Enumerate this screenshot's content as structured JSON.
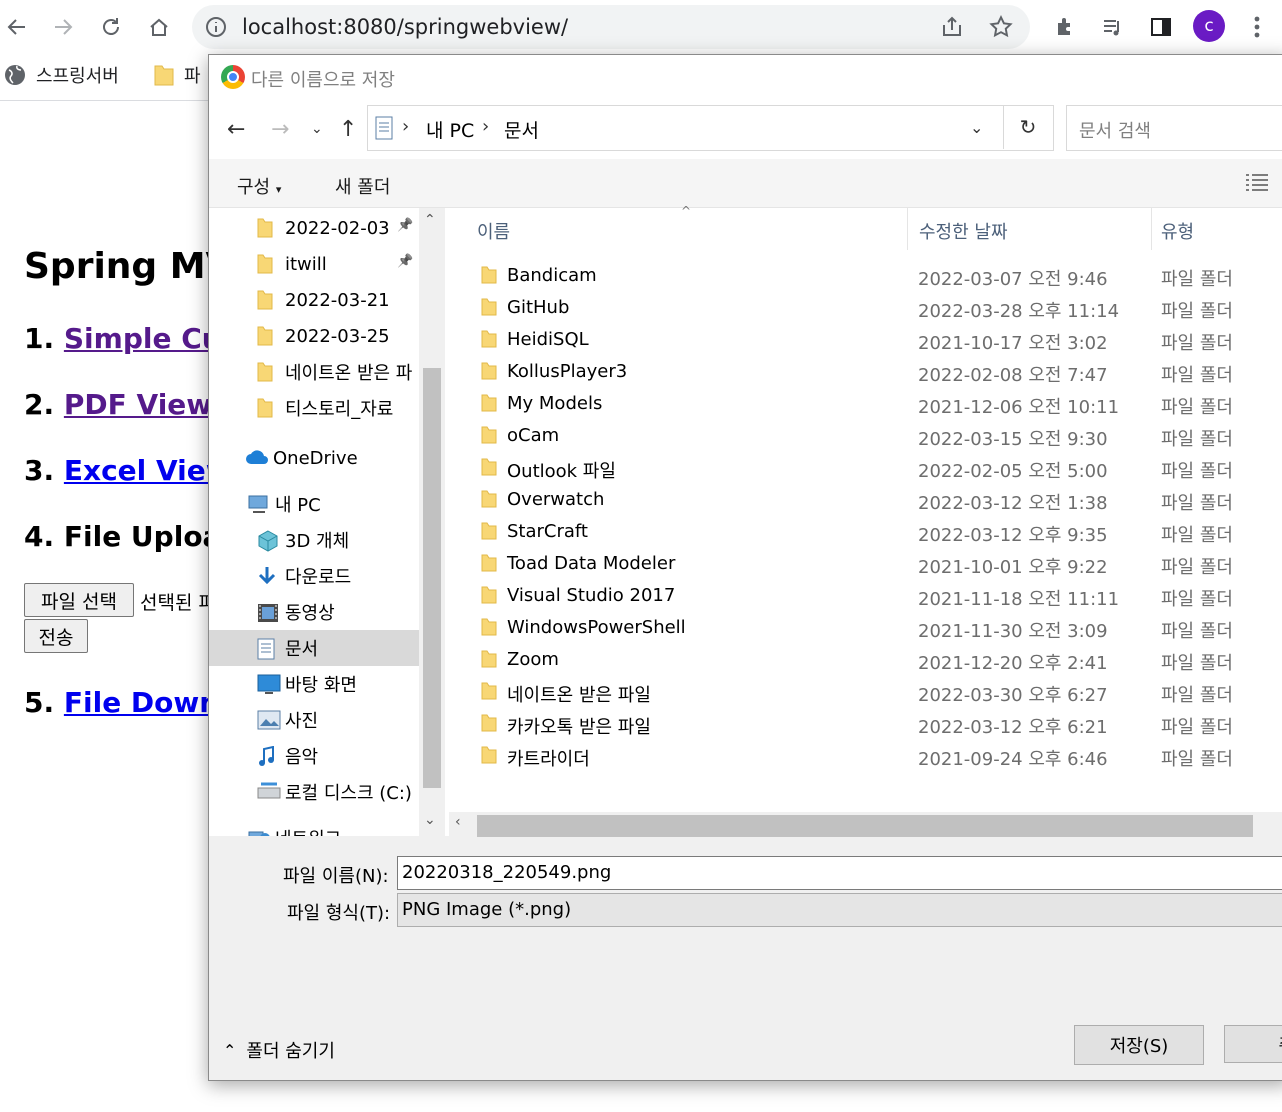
{
  "browser": {
    "url": "localhost:8080/springwebview/",
    "avatar_letter": "c",
    "bookmarks": [
      "스프링서버",
      "파"
    ]
  },
  "page": {
    "title": "Spring MV",
    "items": [
      {
        "num": "1.",
        "link": "Simple Cust",
        "visited": true
      },
      {
        "num": "2.",
        "link": "PDF View",
        "visited": true
      },
      {
        "num": "3.",
        "link": "Excel View",
        "visited": false
      },
      {
        "num": "4.",
        "text": "File Upload"
      },
      {
        "num": "5.",
        "link": "File Downlo",
        "visited": false
      }
    ],
    "choose_file_label": "파일 선택",
    "no_file_text": "선택된 파",
    "submit_label": "전송"
  },
  "dialog": {
    "title": "다른 이름으로 저장",
    "breadcrumb": [
      "내 PC",
      "문서"
    ],
    "search_placeholder": "문서 검색",
    "organize_label": "구성",
    "new_folder_label": "새 폴더",
    "nav_items": [
      {
        "label": "2022-02-03",
        "icon": "folder-icon",
        "pinned": true
      },
      {
        "label": "itwill",
        "icon": "folder-icon",
        "pinned": true
      },
      {
        "label": "2022-03-21",
        "icon": "folder-icon",
        "pinned": false
      },
      {
        "label": "2022-03-25",
        "icon": "folder-icon",
        "pinned": false
      },
      {
        "label": "네이트온 받은 파",
        "icon": "folder-icon",
        "pinned": false
      },
      {
        "label": "티스토리_자료",
        "icon": "folder-icon",
        "pinned": false
      },
      {
        "label": "OneDrive",
        "icon": "cloud-icon",
        "pinned": false
      },
      {
        "label": "내 PC",
        "icon": "computer-icon",
        "pinned": false
      },
      {
        "label": "3D 개체",
        "icon": "cube-icon",
        "pinned": false
      },
      {
        "label": "다운로드",
        "icon": "download-icon",
        "pinned": false
      },
      {
        "label": "동영상",
        "icon": "video-icon",
        "pinned": false
      },
      {
        "label": "문서",
        "icon": "document-icon",
        "pinned": false,
        "selected": true
      },
      {
        "label": "바탕 화면",
        "icon": "desktop-icon",
        "pinned": false
      },
      {
        "label": "사진",
        "icon": "picture-icon",
        "pinned": false
      },
      {
        "label": "음악",
        "icon": "music-icon",
        "pinned": false
      },
      {
        "label": "로컬 디스크 (C:)",
        "icon": "disk-icon",
        "pinned": false
      },
      {
        "label": "네트워크",
        "icon": "network-icon",
        "pinned": false
      }
    ],
    "columns": [
      "이름",
      "수정한 날짜",
      "유형"
    ],
    "files": [
      {
        "name": "Bandicam",
        "date": "2022-03-07 오전 9:46",
        "type": "파일 폴더"
      },
      {
        "name": "GitHub",
        "date": "2022-03-28 오후 11:14",
        "type": "파일 폴더"
      },
      {
        "name": "HeidiSQL",
        "date": "2021-10-17 오전 3:02",
        "type": "파일 폴더"
      },
      {
        "name": "KollusPlayer3",
        "date": "2022-02-08 오전 7:47",
        "type": "파일 폴더"
      },
      {
        "name": "My Models",
        "date": "2021-12-06 오전 10:11",
        "type": "파일 폴더"
      },
      {
        "name": "oCam",
        "date": "2022-03-15 오전 9:30",
        "type": "파일 폴더"
      },
      {
        "name": "Outlook 파일",
        "date": "2022-02-05 오전 5:00",
        "type": "파일 폴더"
      },
      {
        "name": "Overwatch",
        "date": "2022-03-12 오전 1:38",
        "type": "파일 폴더"
      },
      {
        "name": "StarCraft",
        "date": "2022-03-12 오후 9:35",
        "type": "파일 폴더"
      },
      {
        "name": "Toad Data Modeler",
        "date": "2021-10-01 오후 9:22",
        "type": "파일 폴더"
      },
      {
        "name": "Visual Studio 2017",
        "date": "2021-11-18 오전 11:11",
        "type": "파일 폴더"
      },
      {
        "name": "WindowsPowerShell",
        "date": "2021-11-30 오전 3:09",
        "type": "파일 폴더"
      },
      {
        "name": "Zoom",
        "date": "2021-12-20 오후 2:41",
        "type": "파일 폴더"
      },
      {
        "name": "네이트온 받은 파일",
        "date": "2022-03-30 오후 6:27",
        "type": "파일 폴더"
      },
      {
        "name": "카카오톡 받은 파일",
        "date": "2022-03-12 오후 6:21",
        "type": "파일 폴더"
      },
      {
        "name": "카트라이더",
        "date": "2021-09-24 오후 6:46",
        "type": "파일 폴더"
      }
    ],
    "filename_label": "파일 이름(N):",
    "filename_value": "20220318_220549.png",
    "filetype_label": "파일 형식(T):",
    "filetype_value": "PNG Image (*.png)",
    "hide_folders_label": "폴더 숨기기",
    "save_label": "저장(S)",
    "cancel_label": "취"
  },
  "colors": {
    "accent": "#6a1bc4",
    "link": "#0000ee",
    "visited": "#551a8b",
    "folder": "#f8d775"
  }
}
